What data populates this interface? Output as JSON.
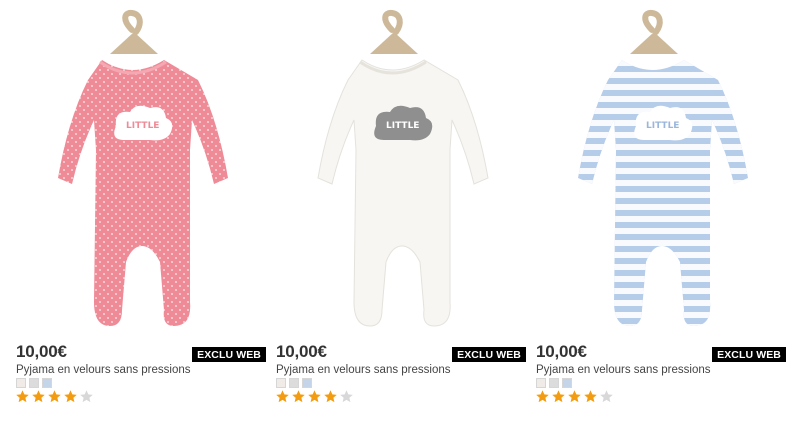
{
  "products": [
    {
      "price": "10,00€",
      "badge": "EXCLU WEB",
      "title": "Pyjama en velours sans pressions",
      "main_color": "#ef8a97",
      "swatches": [
        "#f0ebe6",
        "#dcdcdc",
        "#c4d5ea"
      ],
      "rating": 4,
      "rating_max": 5
    },
    {
      "price": "10,00€",
      "badge": "EXCLU WEB",
      "title": "Pyjama en velours sans pressions",
      "main_color": "#f7f6f2",
      "swatches": [
        "#f0ebe6",
        "#dcdcdc",
        "#c4d5ea"
      ],
      "rating": 4,
      "rating_max": 5
    },
    {
      "price": "10,00€",
      "badge": "EXCLU WEB",
      "title": "Pyjama en velours sans pressions",
      "main_color": "#b6cdea",
      "swatches": [
        "#f0ebe6",
        "#dcdcdc",
        "#c4d5ea"
      ],
      "rating": 4,
      "rating_max": 5
    }
  ],
  "colors": {
    "star_filled": "#f39c12",
    "star_empty": "#d8d8d8",
    "badge_bg": "#000000",
    "badge_text": "#ffffff",
    "hanger": "#cdb99a"
  }
}
